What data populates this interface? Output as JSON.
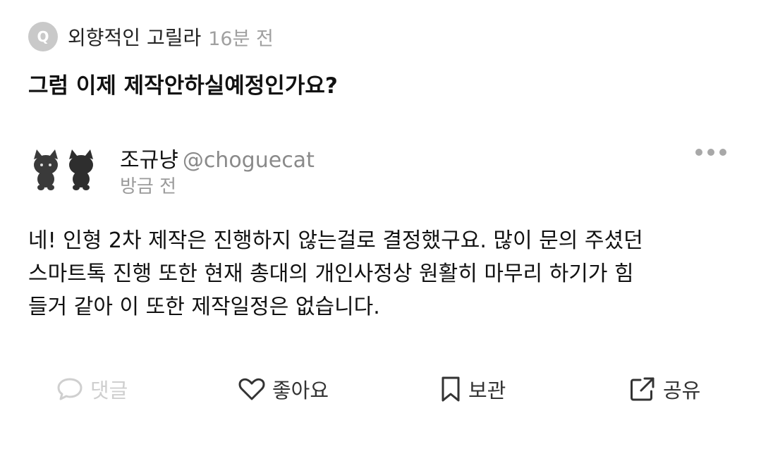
{
  "question": {
    "badge": "Q",
    "user": "외향적인 고릴라",
    "time": "16분 전",
    "text": "그럼 이제 제작안하실예정인가요?"
  },
  "answer": {
    "author_name": "조규냥",
    "author_handle": "@choguecat",
    "time": "방금 전",
    "lines": [
      "네! 인형 2차 제작은 진행하지 않는걸로 결정했구요. 많이 문의 주셨던",
      "스마트톡 진행 또한 현재 총대의 개인사정상 원활히 마무리 하기가 힘",
      "들거 같아 이 또한 제작일정은 없습니다."
    ]
  },
  "actions": {
    "comment_label": "댓글",
    "like_label": "좋아요",
    "save_label": "보관",
    "share_label": "공유"
  },
  "icons": {
    "more": "more-dots-icon",
    "comment": "comment-bubble-icon",
    "like": "heart-icon",
    "save": "bookmark-icon",
    "share": "share-external-icon"
  },
  "colors": {
    "muted": "#a0a0a0",
    "disabled": "#cfcfcf",
    "text": "#111111"
  }
}
